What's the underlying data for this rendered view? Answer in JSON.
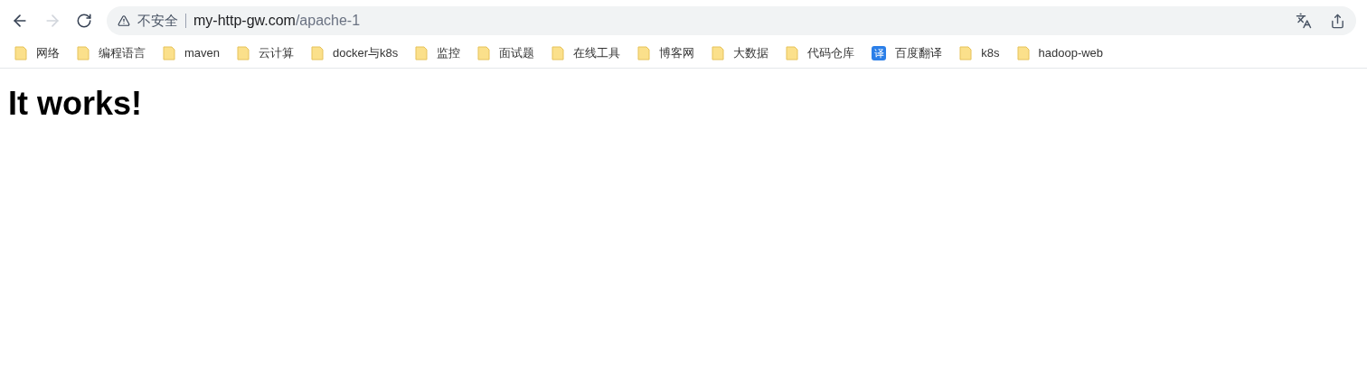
{
  "toolbar": {
    "back": {
      "disabled": false
    },
    "forward": {
      "disabled": true
    },
    "security_label": "不安全",
    "url_host": "my-http-gw.com",
    "url_path": "/apache-1"
  },
  "bookmarks": [
    {
      "kind": "folder",
      "label": "网络"
    },
    {
      "kind": "folder",
      "label": "编程语言"
    },
    {
      "kind": "folder",
      "label": "maven"
    },
    {
      "kind": "folder",
      "label": "云计算"
    },
    {
      "kind": "folder",
      "label": "docker与k8s"
    },
    {
      "kind": "folder",
      "label": "监控"
    },
    {
      "kind": "folder",
      "label": "面试题"
    },
    {
      "kind": "folder",
      "label": "在线工具"
    },
    {
      "kind": "folder",
      "label": "博客网"
    },
    {
      "kind": "folder",
      "label": "大数据"
    },
    {
      "kind": "folder",
      "label": "代码仓库"
    },
    {
      "kind": "site",
      "label": "百度翻译",
      "glyph": "译"
    },
    {
      "kind": "folder",
      "label": "k8s"
    },
    {
      "kind": "folder",
      "label": "hadoop-web"
    }
  ],
  "page": {
    "heading": "It works!"
  }
}
